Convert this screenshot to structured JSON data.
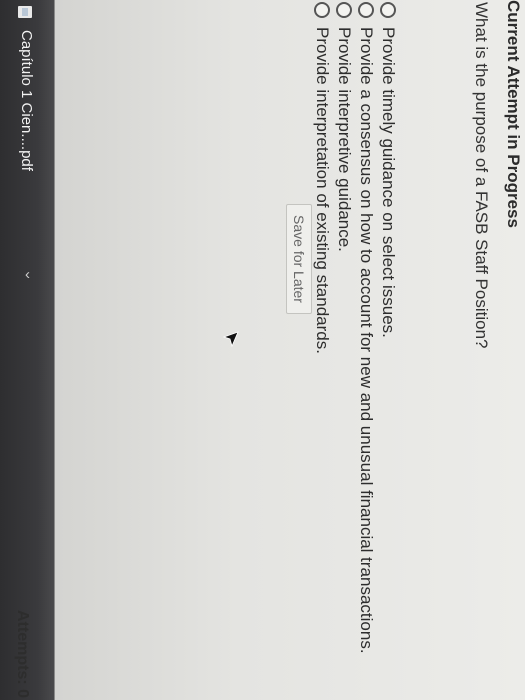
{
  "header": {
    "title": "Current Attempt in Progress"
  },
  "question": {
    "text": "What is the purpose of a FASB Staff Position?",
    "options": [
      "Provide timely guidance on select issues.",
      "Provide a consensus on how to account for new and unusual financial transactions.",
      "Provide interpretive guidance.",
      "Provide interpretation of existing standards."
    ]
  },
  "actions": {
    "save_label": "Save for Later"
  },
  "footer": {
    "attempts_label": "Attempts: 0"
  },
  "download_bar": {
    "file_name": "Capítulo 1 Cien....pdf",
    "file_icon": "pdf-file-icon",
    "menu_icon": "chevron-up-icon"
  }
}
